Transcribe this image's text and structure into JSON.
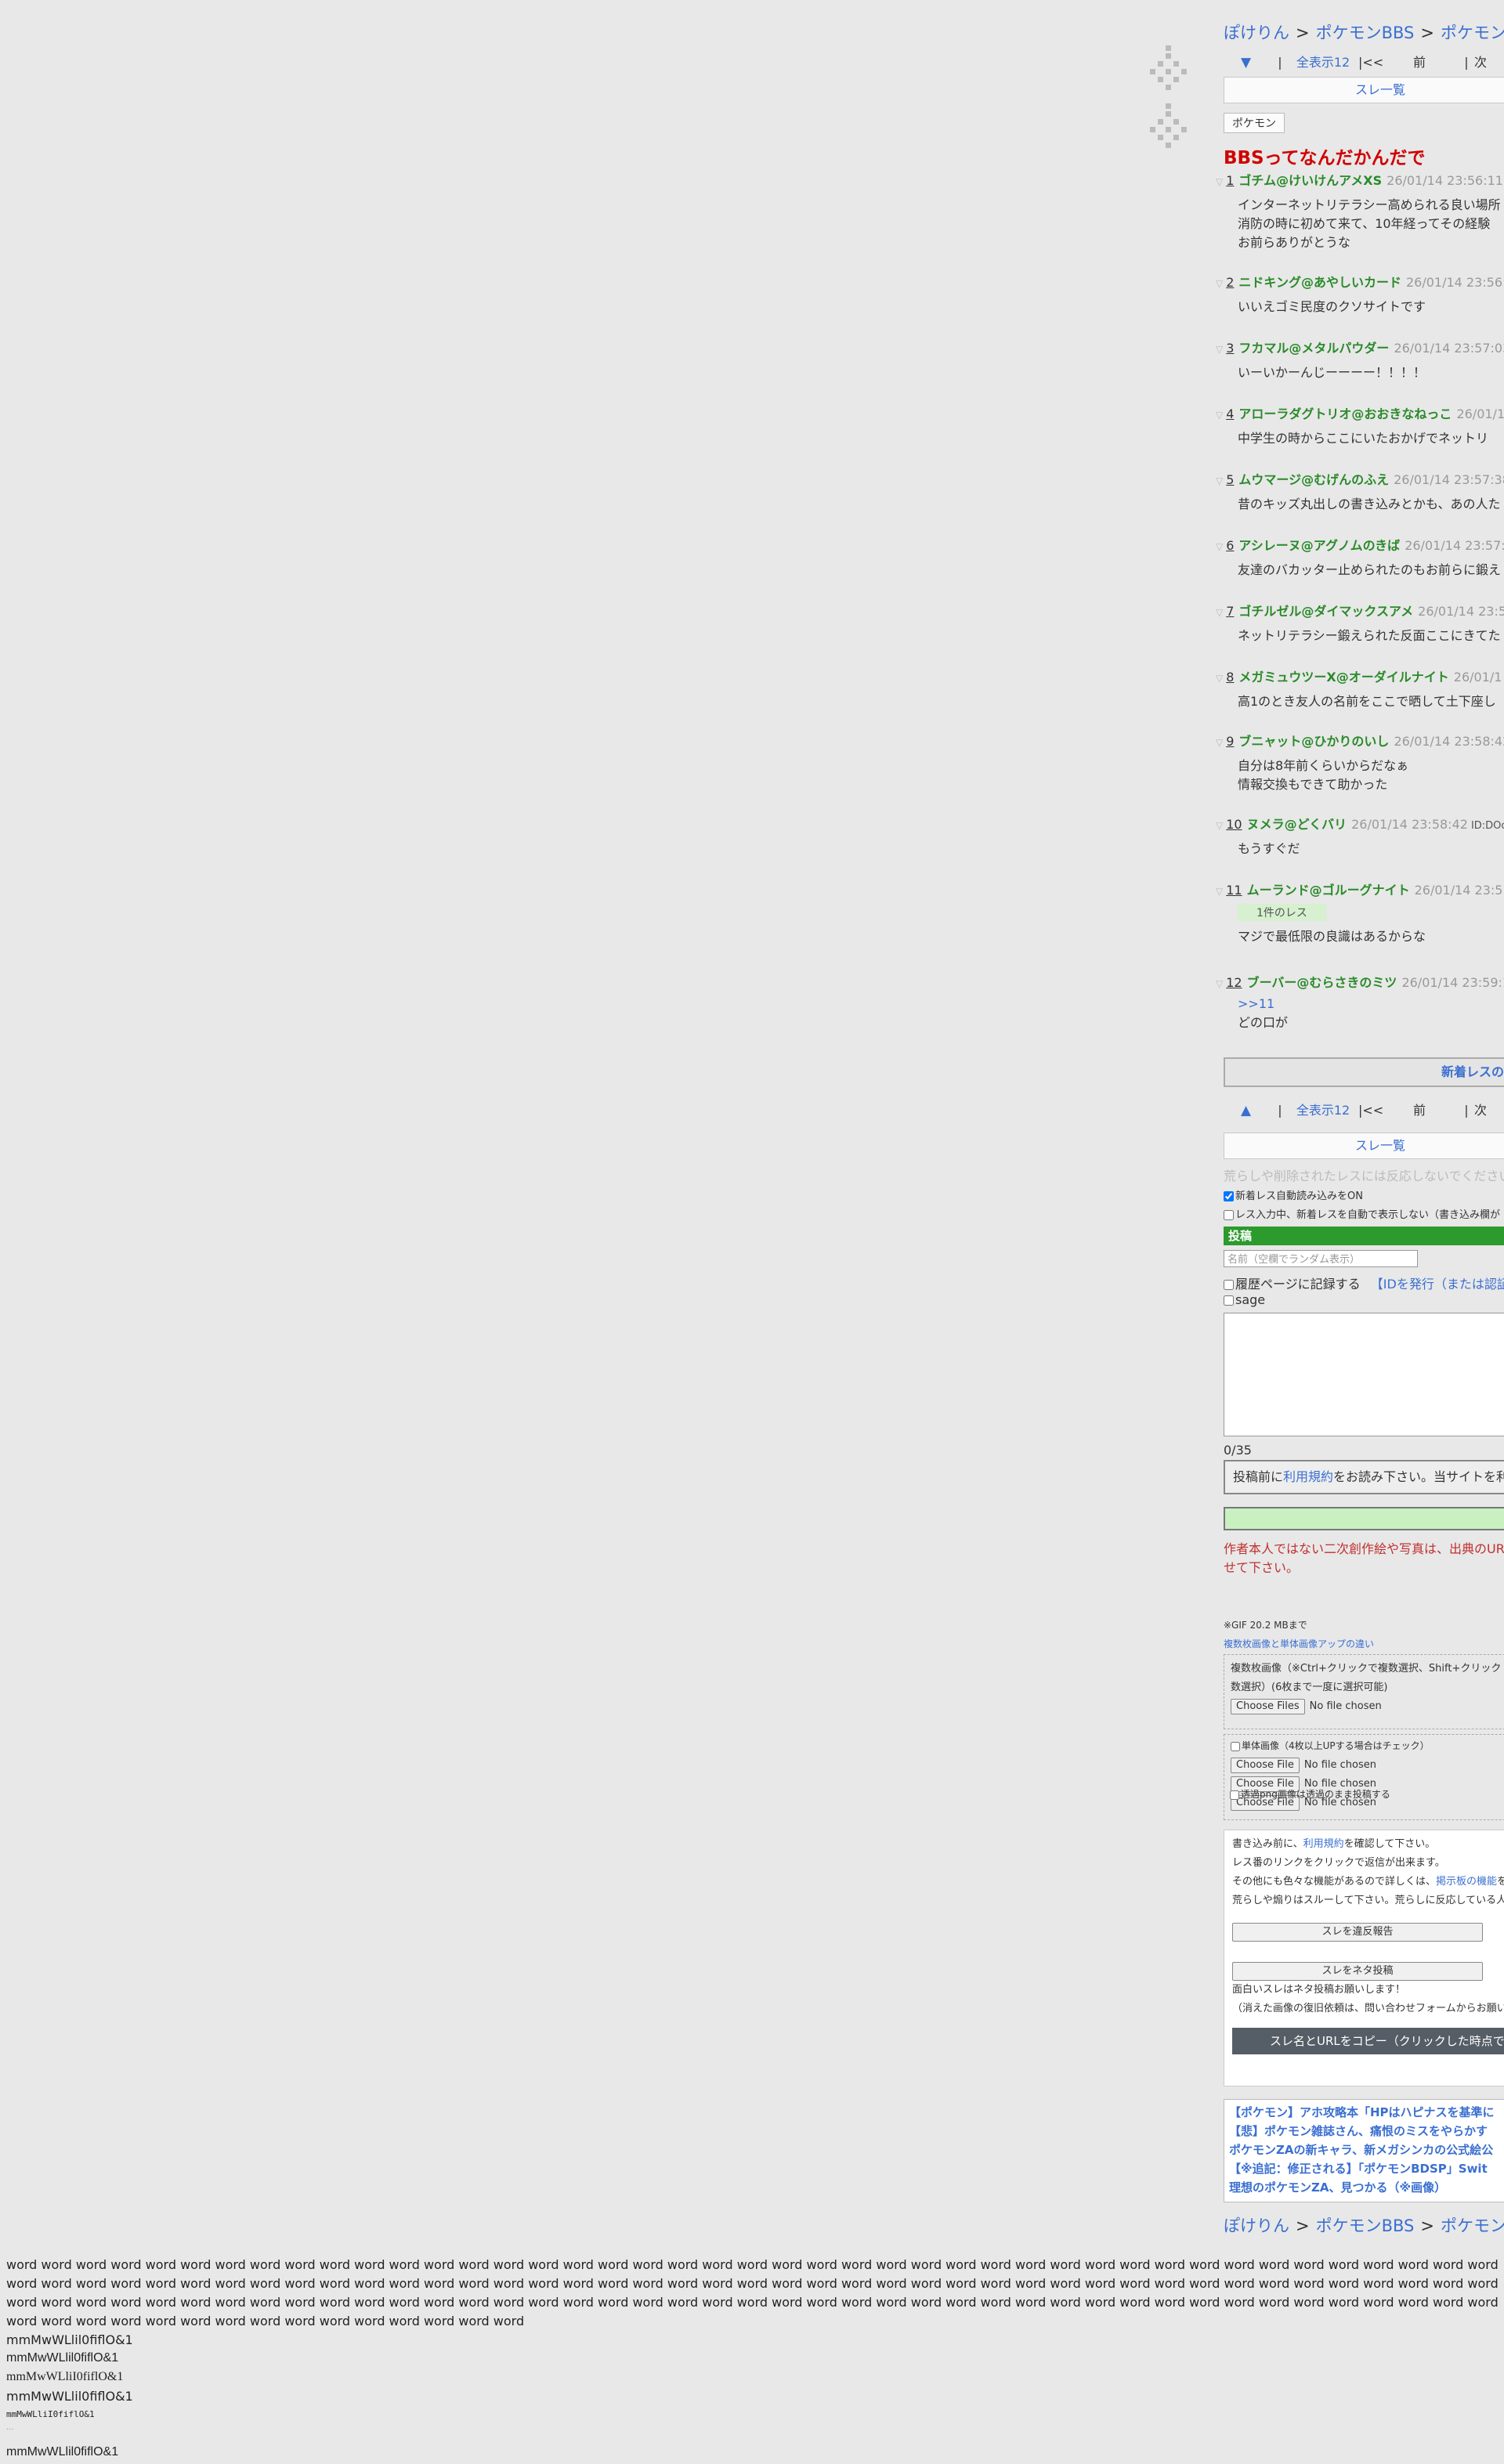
{
  "breadcrumb": [
    "ぽけりん",
    "ポケモンBBS",
    "ポケモン"
  ],
  "breadcrumb_sep": ">",
  "pager_top": {
    "arrow": "▼",
    "bar": "|",
    "all": "全表示12",
    "first": "|<<",
    "prev": "前",
    "next": "次"
  },
  "pager_bottom": {
    "arrow": "▲",
    "bar": "|",
    "all": "全表示12",
    "first": "|<<",
    "prev": "前",
    "next": "次"
  },
  "thread_list_label": "スレ一覧",
  "category_tag": "ポケモン",
  "thread_title": "BBSってなんだかんだで",
  "posts": [
    {
      "num": "1",
      "name": "ゴチム@けいけんアメXS",
      "date": "26/01/14 23:56:11",
      "id": "",
      "reply": "",
      "anchor": "",
      "body": [
        "インターネットリテラシー高められる良い場所",
        "消防の時に初めて来て、10年経ってその経験",
        "お前らありがとうな"
      ]
    },
    {
      "num": "2",
      "name": "ニドキング@あやしいカード",
      "date": "26/01/14 23:56:",
      "id": "",
      "reply": "",
      "anchor": "",
      "body": [
        "いいえゴミ民度のクソサイトです"
      ]
    },
    {
      "num": "3",
      "name": "フカマル@メタルパウダー",
      "date": "26/01/14 23:57:03",
      "id": "",
      "reply": "",
      "anchor": "",
      "body": [
        "いーいかーんじーーーー！！！！"
      ]
    },
    {
      "num": "4",
      "name": "アローラダグトリオ@おおきなねっこ",
      "date": "26/01/1",
      "id": "",
      "reply": "",
      "anchor": "",
      "body": [
        "中学生の時からここにいたおかげでネットリ"
      ]
    },
    {
      "num": "5",
      "name": "ムウマージ@むげんのふえ",
      "date": "26/01/14 23:57:38",
      "id": "",
      "reply": "",
      "anchor": "",
      "body": [
        "昔のキッズ丸出しの書き込みとかも、あの人た"
      ]
    },
    {
      "num": "6",
      "name": "アシレーヌ@アグノムのきば",
      "date": "26/01/14 23:57:",
      "id": "",
      "reply": "",
      "anchor": "",
      "body": [
        "友達のバカッター止められたのもお前らに鍛え"
      ]
    },
    {
      "num": "7",
      "name": "ゴチルゼル@ダイマックスアメ",
      "date": "26/01/14 23:5",
      "id": "",
      "reply": "",
      "anchor": "",
      "body": [
        "ネットリテラシー鍛えられた反面ここにきてた"
      ]
    },
    {
      "num": "8",
      "name": "メガミュウツーX@オーダイルナイト",
      "date": "26/01/1",
      "id": "",
      "reply": "",
      "anchor": "",
      "body": [
        "高1のとき友人の名前をここで晒して土下座し"
      ]
    },
    {
      "num": "9",
      "name": "ブニャット@ひかりのいし",
      "date": "26/01/14 23:58:42",
      "id": "",
      "reply": "",
      "anchor": "",
      "body": [
        "自分は8年前くらいからだなぁ",
        "情報交換もできて助かった"
      ]
    },
    {
      "num": "10",
      "name": "ヌメラ@どくバリ",
      "date": "26/01/14 23:58:42",
      "id": "ID:DOo",
      "reply": "",
      "anchor": "",
      "body": [
        "もうすぐだ"
      ]
    },
    {
      "num": "11",
      "name": "ムーランド@ゴルーグナイト",
      "date": "26/01/14 23:5",
      "id": "",
      "reply": "1件のレス",
      "anchor": "",
      "body": [
        "マジで最低限の良識はあるからな"
      ]
    },
    {
      "num": "12",
      "name": "ブーバー@むらさきのミツ",
      "date": "26/01/14 23:59:1",
      "id": "",
      "reply": "",
      "anchor": ">>11",
      "body": [
        "どの口が"
      ]
    }
  ],
  "new_reply_check": "新着レスの確認",
  "ignore_note": "荒らしや削除されたレスには反応しないでください",
  "auto_load_label": "新着レス自動読み込みをON",
  "no_show_label": "レス入力中、新着レスを自動で表示しない（書き込み欄が",
  "form": {
    "header": "投稿",
    "name_placeholder": "名前（空欄でランダム表示）",
    "history_label": "履歴ページに記録する",
    "id_link": "【IDを発行（または認証",
    "sage_label": "sage",
    "counter": "0/35",
    "terms_pre": "投稿前に",
    "terms_link": "利用規約",
    "terms_post": "をお読み下さい。当サイトを利"
  },
  "warning": "作者本人ではない二次創作絵や写真は、出典のURLを載せて下さい。",
  "gif_note": "※GIF 20.2 MBまで",
  "upload_diff_link": "複数枚画像と単体画像アップの違い",
  "multi_upload": {
    "desc1": "複数枚画像（※Ctrl+クリックで複数選択、Shift+クリック",
    "desc2": "数選択）(6枚まで一度に選択可能)",
    "button": "Choose Files",
    "status": "No file chosen"
  },
  "single_upload": {
    "label": "単体画像（4枚以上UPする場合はチェック）",
    "button": "Choose File",
    "status": "No file chosen",
    "count": 3
  },
  "png_label": "透過png画像は透過のまま投稿する",
  "info": {
    "line1_pre": "書き込み前に、",
    "line1_link": "利用規約",
    "line1_post": "を確認して下さい。",
    "line2": "レス番のリンクをクリックで返信が出来ます。",
    "line3_pre": "その他にも色々な機能があるので詳しくは、",
    "line3_link": "掲示板の機能",
    "line3_post": "を",
    "line4": "荒らしや煽りはスルーして下さい。荒らしに反応している人",
    "report_button": "スレを違反報告",
    "neta_button": "スレをネタ投稿",
    "neta_note1": "面白いスレはネタ投稿お願いします！",
    "neta_note2": "（消えた画像の復旧依頼は、問い合わせフォームからお願い",
    "copy_button": "スレ名とURLをコピー（クリックした時点で"
  },
  "related": [
    "【ポケモン】アホ攻略本「HPはハピナスを基準に",
    "【悲】ポケモン雑誌さん、痛恨のミスをやらかす",
    "ポケモンZAの新キャラ、新メガシンカの公式絵公",
    "【※追記：修正される】「ポケモンBDSP」Swit",
    "理想のポケモンZA、見つかる（※画像）"
  ],
  "filler": {
    "words": "word word word word word word word word word word word word word word word word word word word word word word word word word word word word word word word word word word word word word word word word word word word word word word word word word word word word word word word word word word word word word word word word word word word word word word word word word word word word word word word word word word word word word word word word word word word word word word word word word word word word word word word word word word word word word word word word word word word word word word word word word word word word word word word word word word word word word word word word word word word word word word word word",
    "sample1": "mmMwWLlil0fiflO&1",
    "sample2": "mmMwWLlil0fiflO&1",
    "sample3": "mmMwWLliI0fiflO&1",
    "sample4": "mmMwWLlil0fiflO&1",
    "sample_mono": "mmMwWLliI0fiflO&1",
    "sample_dots": "...",
    "sample5": "mmMwWLlil0fiflO&1"
  }
}
